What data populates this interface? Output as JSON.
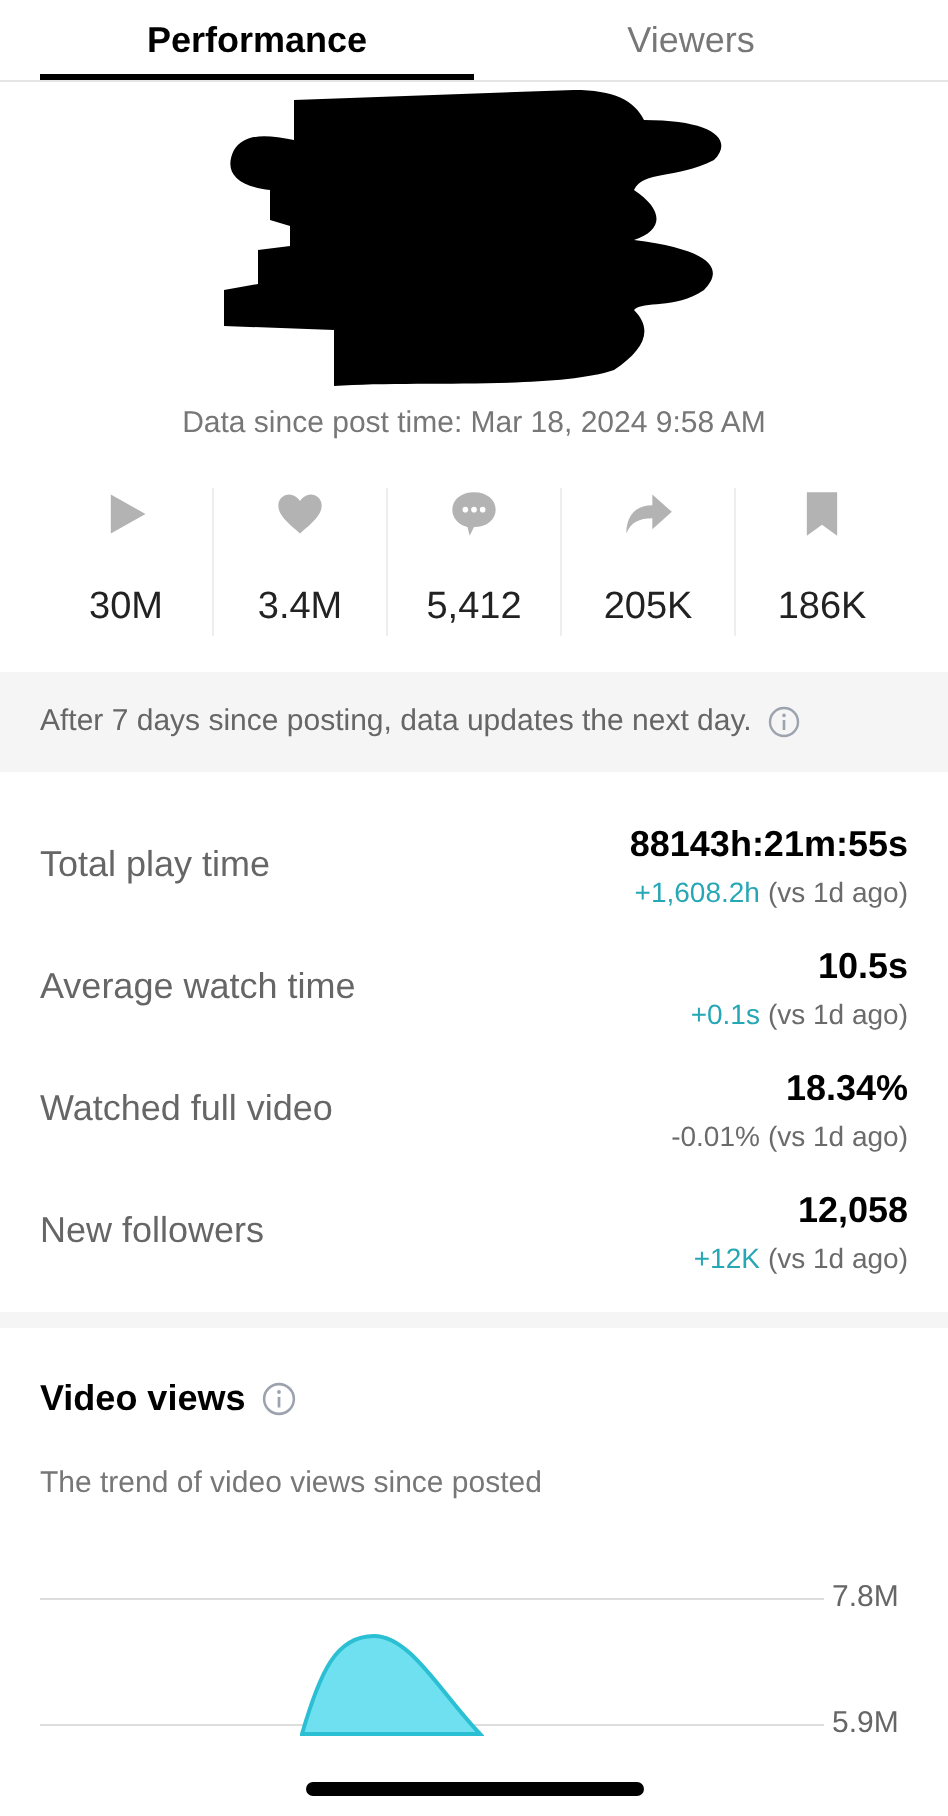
{
  "tabs": [
    {
      "label": "Performance",
      "selected": true
    },
    {
      "label": "Viewers",
      "selected": false
    }
  ],
  "post_time": "Data since post time: Mar 18, 2024 9:58 AM",
  "stats": [
    {
      "kind": "play",
      "value": "30M"
    },
    {
      "kind": "like",
      "value": "3.4M"
    },
    {
      "kind": "comment",
      "value": "5,412"
    },
    {
      "kind": "share",
      "value": "205K"
    },
    {
      "kind": "save",
      "value": "186K"
    }
  ],
  "notice": "After 7 days since posting, data updates the next day.",
  "metrics": [
    {
      "label": "Total play time",
      "value": "88143h:21m:55s",
      "change": "+1,608.2h",
      "positive": true,
      "compare": "(vs 1d ago)"
    },
    {
      "label": "Average watch time",
      "value": "10.5s",
      "change": "+0.1s",
      "positive": true,
      "compare": "(vs 1d ago)"
    },
    {
      "label": "Watched full video",
      "value": "18.34%",
      "change": "-0.01%",
      "positive": false,
      "compare": "(vs 1d ago)"
    },
    {
      "label": "New followers",
      "value": "12,058",
      "change": "+12K",
      "positive": true,
      "compare": "(vs 1d ago)"
    }
  ],
  "video_views": {
    "title": "Video views",
    "subtitle": "The trend of video views since posted",
    "gridlines": [
      "7.8M",
      "5.9M"
    ]
  }
}
